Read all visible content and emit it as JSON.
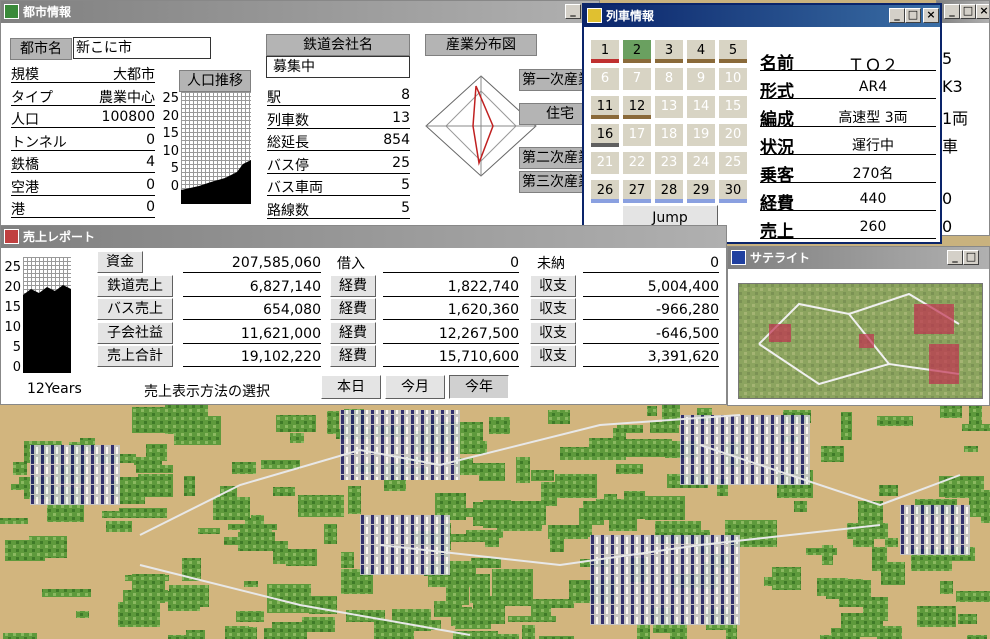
{
  "city_window": {
    "title": "都市情報",
    "city_name_label": "都市名",
    "city_name": "新こに市",
    "stats": [
      {
        "label": "規模",
        "value": "大都市"
      },
      {
        "label": "タイプ",
        "value": "農業中心"
      },
      {
        "label": "人口",
        "value": "100800"
      },
      {
        "label": "トンネル",
        "value": "0"
      },
      {
        "label": "鉄橋",
        "value": "4"
      },
      {
        "label": "空港",
        "value": "0"
      },
      {
        "label": "港",
        "value": "0"
      }
    ],
    "pop_button": "人口推移",
    "pop_axis": [
      "25",
      "20",
      "15",
      "10",
      "5",
      "0"
    ],
    "company_label": "鉄道会社名",
    "company_value": "募集中",
    "company_stats": [
      {
        "label": "駅",
        "value": "8"
      },
      {
        "label": "列車数",
        "value": "13"
      },
      {
        "label": "総延長",
        "value": "854"
      },
      {
        "label": "バス停",
        "value": "25"
      },
      {
        "label": "バス車両",
        "value": "5"
      },
      {
        "label": "路線数",
        "value": "5"
      }
    ],
    "industry_button": "産業分布図",
    "industry_labels": [
      "第一次産業",
      "住宅",
      "第二次産業",
      "第三次産業"
    ]
  },
  "train_window": {
    "title": "列車情報",
    "cells": [
      {
        "n": "1",
        "on": true,
        "bar": "#c03030"
      },
      {
        "n": "2",
        "on": true,
        "bar": "#8a6a3a",
        "sel": true
      },
      {
        "n": "3",
        "on": true,
        "bar": "#8a6a3a"
      },
      {
        "n": "4",
        "on": true,
        "bar": "#8a6a3a"
      },
      {
        "n": "5",
        "on": true,
        "bar": "#8a6a3a"
      },
      {
        "n": "6",
        "on": false
      },
      {
        "n": "7",
        "on": false
      },
      {
        "n": "8",
        "on": false
      },
      {
        "n": "9",
        "on": false
      },
      {
        "n": "10",
        "on": false
      },
      {
        "n": "11",
        "on": true,
        "bar": "#8a6a3a"
      },
      {
        "n": "12",
        "on": true,
        "bar": "#8a6a3a"
      },
      {
        "n": "13",
        "on": false
      },
      {
        "n": "14",
        "on": false
      },
      {
        "n": "15",
        "on": false
      },
      {
        "n": "16",
        "on": true,
        "bar": "#606060"
      },
      {
        "n": "17",
        "on": false
      },
      {
        "n": "18",
        "on": false
      },
      {
        "n": "19",
        "on": false
      },
      {
        "n": "20",
        "on": false
      },
      {
        "n": "21",
        "on": false
      },
      {
        "n": "22",
        "on": false
      },
      {
        "n": "23",
        "on": false
      },
      {
        "n": "24",
        "on": false
      },
      {
        "n": "25",
        "on": false
      },
      {
        "n": "26",
        "on": true,
        "bar": "#8aa0e0"
      },
      {
        "n": "27",
        "on": true,
        "bar": "#8aa0e0"
      },
      {
        "n": "28",
        "on": true,
        "bar": "#8aa0e0"
      },
      {
        "n": "29",
        "on": true,
        "bar": "#8aa0e0"
      },
      {
        "n": "30",
        "on": true,
        "bar": "#8aa0e0"
      }
    ],
    "jump_label": "Jump",
    "details": [
      {
        "label": "名前",
        "value": "ＴＯ２"
      },
      {
        "label": "形式",
        "value": "AR4"
      },
      {
        "label": "編成",
        "value": "高速型 3両"
      },
      {
        "label": "状況",
        "value": "運行中"
      },
      {
        "label": "乗客",
        "value": "270名"
      },
      {
        "label": "経費",
        "value": "440"
      },
      {
        "label": "売上",
        "value": "260"
      }
    ]
  },
  "behind_window": {
    "values": [
      "5",
      "K3",
      "1両",
      "車",
      "",
      "0",
      "0"
    ]
  },
  "sales_window": {
    "title": "売上レポート",
    "chart_axis": [
      "25",
      "20",
      "15",
      "10",
      "5",
      "0"
    ],
    "years_label": "12Years",
    "rows": [
      {
        "label": "資金",
        "value": "207,585,060",
        "mid_label": "借入",
        "mid_value": "0",
        "right_label": "未納",
        "right_value": "0"
      },
      {
        "label": "鉄道売上",
        "value": "6,827,140",
        "mid_label": "経費",
        "mid_value": "1,822,740",
        "right_label": "収支",
        "right_value": "5,004,400"
      },
      {
        "label": "バス売上",
        "value": "654,080",
        "mid_label": "経費",
        "mid_value": "1,620,360",
        "right_label": "収支",
        "right_value": "-966,280"
      },
      {
        "label": "子会社益",
        "value": "11,621,000",
        "mid_label": "経費",
        "mid_value": "12,267,500",
        "right_label": "収支",
        "right_value": "-646,500"
      },
      {
        "label": "売上合計",
        "value": "19,102,220",
        "mid_label": "経費",
        "mid_value": "15,710,600",
        "right_label": "収支",
        "right_value": "3,391,620"
      }
    ],
    "select_label": "売上表示方法の選択",
    "period_buttons": [
      "本日",
      "今月",
      "今年"
    ],
    "period_selected": "今年"
  },
  "satellite_window": {
    "title": "サテライト"
  },
  "window_buttons": {
    "minimize": "_",
    "maximize": "□",
    "close": "×"
  }
}
